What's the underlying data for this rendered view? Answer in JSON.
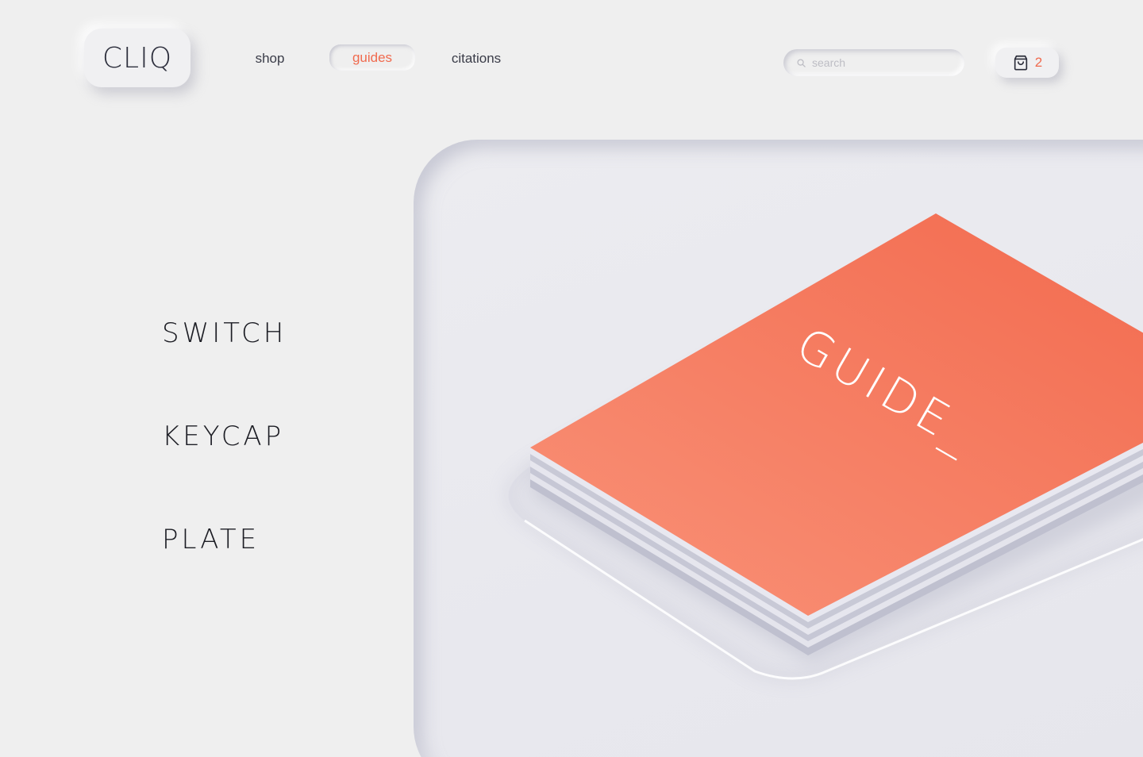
{
  "brand": {
    "logo_text": "CLIQ"
  },
  "nav": {
    "items": [
      {
        "label": "shop",
        "active": false
      },
      {
        "label": "guides",
        "active": true
      },
      {
        "label": "citations",
        "active": false
      }
    ]
  },
  "search": {
    "placeholder": "search",
    "value": ""
  },
  "cart": {
    "icon": "shopping-bag-icon",
    "count": "2"
  },
  "categories": [
    {
      "label": "SWITCH"
    },
    {
      "label": "KEYCAP"
    },
    {
      "label": "PLATE"
    }
  ],
  "hero": {
    "book_title": "GUIDE_"
  },
  "colors": {
    "accent": "#f06a4e",
    "background": "#efefef",
    "text": "#2b2d3a"
  }
}
